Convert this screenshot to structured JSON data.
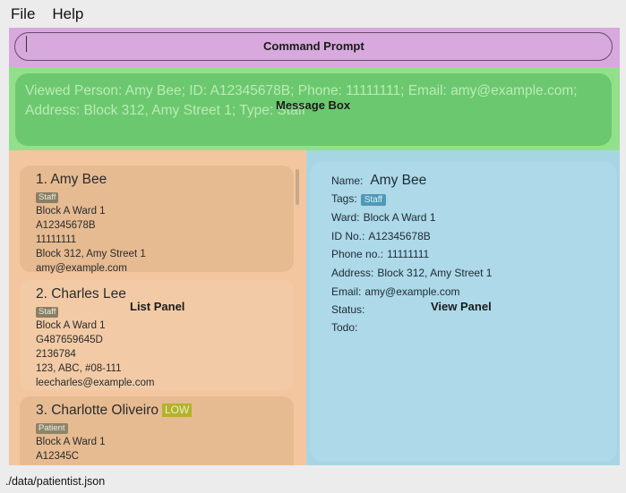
{
  "menubar": {
    "items": [
      "File",
      "Help"
    ]
  },
  "command": {
    "label": "Command Prompt",
    "value": ""
  },
  "message": {
    "label": "Message Box",
    "text": "Viewed Person: Amy Bee; ID: A12345678B; Phone: 11111111; Email: amy@example.com; Address: Block 312, Amy Street 1; Type: Staff"
  },
  "list": {
    "label": "List Panel",
    "persons": [
      {
        "name": "1.  Amy Bee",
        "tag": "Staff",
        "ward": "Block A Ward 1",
        "id": "A12345678B",
        "phone": "11111111",
        "address": "Block 312, Amy Street 1",
        "email": "amy@example.com"
      },
      {
        "name": "2.  Charles Lee",
        "tag": "Staff",
        "ward": "Block A Ward 1",
        "id": "G487659645D",
        "phone": "2136784",
        "address": "123, ABC, #08-111",
        "email": "leecharles@example.com"
      },
      {
        "name": "3.  Charlotte Oliveiro",
        "priority": "LOW",
        "tag": "Patient",
        "ward": "Block A Ward 1",
        "id": "A12345C"
      }
    ]
  },
  "view": {
    "label": "View Panel",
    "name_label": "Name:",
    "name": "Amy Bee",
    "tags_label": "Tags:",
    "tag": "Staff",
    "ward_label": "Ward:",
    "ward": "Block A Ward 1",
    "id_label": "ID No.:",
    "id": "A12345678B",
    "phone_label": "Phone no.:",
    "phone": "11111111",
    "address_label": "Address:",
    "address": "Block 312, Amy Street 1",
    "email_label": "Email:",
    "email": "amy@example.com",
    "status_label": "Status:",
    "todo_label": "Todo:"
  },
  "status_bar": {
    "path": "./data/patientist.json"
  },
  "colors": {
    "command_zone": "#d7a9dc",
    "message_zone": "#93e08c",
    "list_zone": "#f4c6a0",
    "view_zone": "#a6d6e4",
    "priority_low": "#b3b22e"
  }
}
